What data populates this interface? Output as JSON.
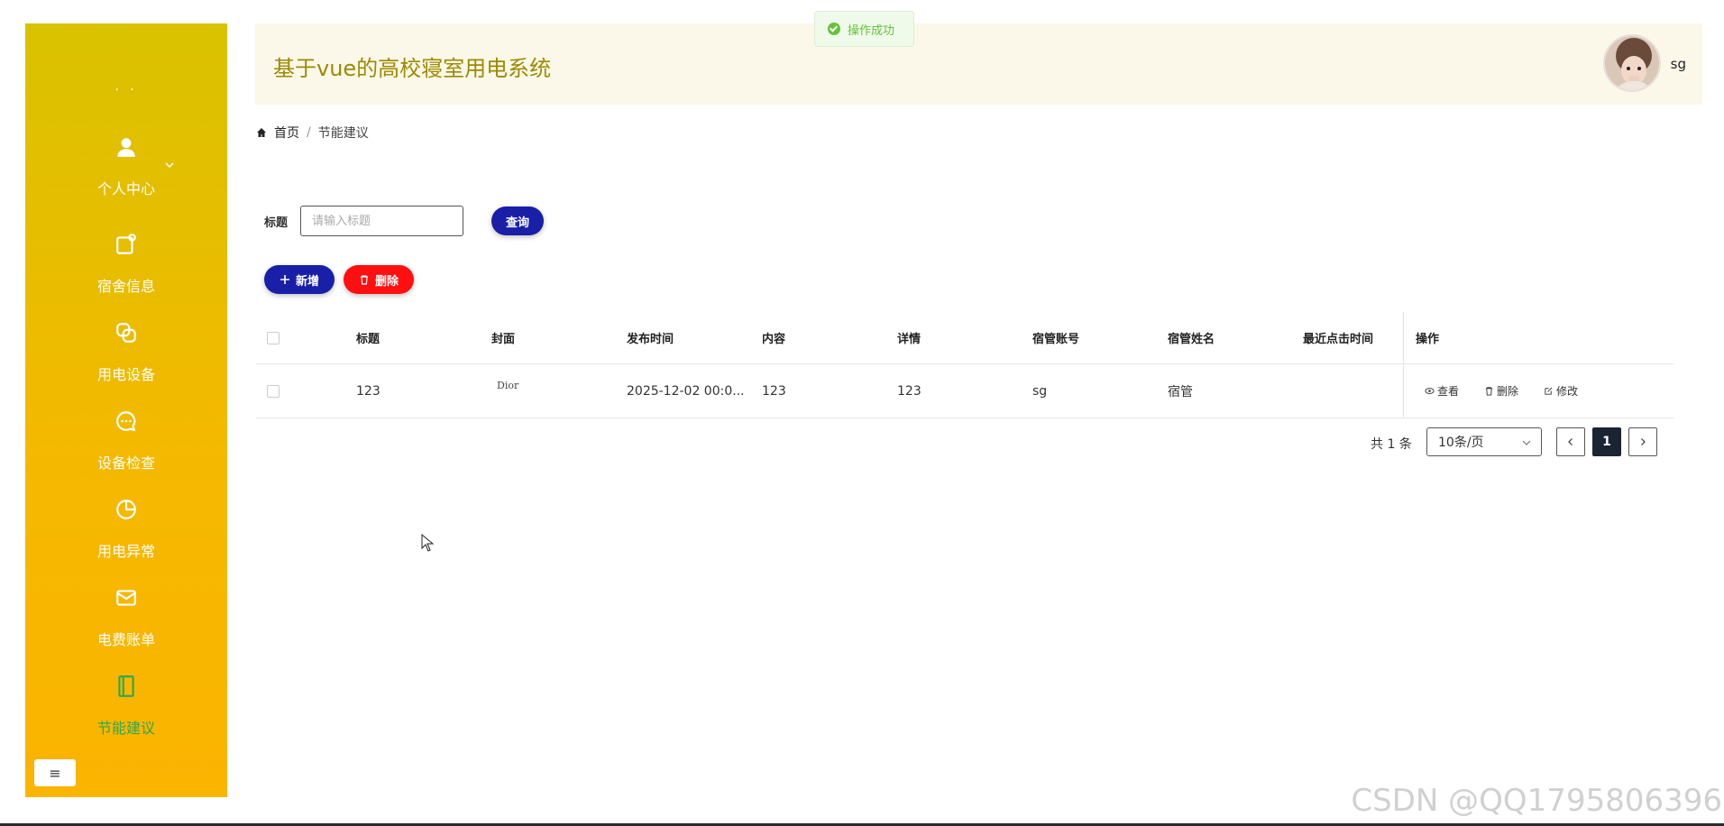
{
  "app": {
    "title": "基于vue的高校寝室用电系统",
    "username": "sg"
  },
  "toast": {
    "message": "操作成功"
  },
  "sidebar": {
    "dots": "· ·",
    "items": [
      {
        "label": "个人中心",
        "icon": "user-icon"
      },
      {
        "label": "宿舍信息",
        "icon": "dorm-info-icon"
      },
      {
        "label": "用电设备",
        "icon": "device-icon"
      },
      {
        "label": "设备检查",
        "icon": "chat-icon"
      },
      {
        "label": "用电异常",
        "icon": "pie-icon"
      },
      {
        "label": "电费账单",
        "icon": "mail-icon"
      },
      {
        "label": "节能建议",
        "icon": "notebook-icon"
      }
    ],
    "active_index": 6,
    "collapse_glyph": "≡"
  },
  "breadcrumb": {
    "home": "首页",
    "separator": "/",
    "current": "节能建议"
  },
  "search": {
    "label": "标题",
    "placeholder": "请输入标题",
    "value": "",
    "button": "查询"
  },
  "actions": {
    "add": "新增",
    "delete": "删除"
  },
  "table": {
    "columns": [
      "标题",
      "封面",
      "发布时间",
      "内容",
      "详情",
      "宿管账号",
      "宿管姓名",
      "最近点击时间",
      "操作"
    ],
    "rows": [
      {
        "title": "123",
        "cover": "Dior",
        "publish_time": "2025-12-02 00:0...",
        "content": "123",
        "detail": "123",
        "account": "sg",
        "name": "宿管",
        "last_click": ""
      }
    ],
    "row_ops": {
      "view": "查看",
      "delete": "删除",
      "edit": "修改"
    }
  },
  "pagination": {
    "total": "共 1 条",
    "page_size": "10条/页",
    "current_page": "1"
  },
  "watermark": "CSDN @QQ1795806396",
  "colors": {
    "primary": "#1a1fa8",
    "danger": "#ff1010",
    "sidebar_top": "#d9c200",
    "sidebar_bottom": "#fbb400",
    "active": "#2fa84f"
  }
}
